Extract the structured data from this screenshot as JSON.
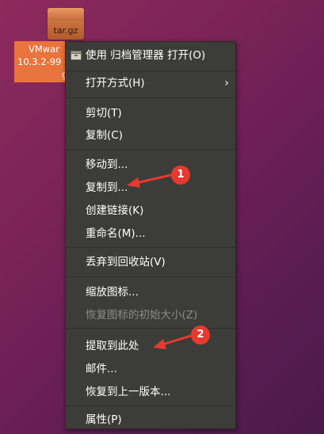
{
  "desktop": {
    "file": {
      "icon_label": "tar.gz",
      "name_line1": "VMwar",
      "name_line2": "10.3.2-99",
      "name_line3": "g"
    }
  },
  "context_menu": {
    "items": [
      {
        "label": "使用 归档管理器 打开(O)"
      },
      {
        "label": "打开方式(H)"
      },
      {
        "label": "剪切(T)"
      },
      {
        "label": "复制(C)"
      },
      {
        "label": "移动到..."
      },
      {
        "label": "复制到..."
      },
      {
        "label": "创建链接(K)"
      },
      {
        "label": "重命名(M)..."
      },
      {
        "label": "丢弃到回收站(V)"
      },
      {
        "label": "缩放图标..."
      },
      {
        "label": "恢复图标的初始大小(Z)"
      },
      {
        "label": "提取到此处"
      },
      {
        "label": "邮件..."
      },
      {
        "label": "恢复到上一版本..."
      },
      {
        "label": "属性(P)"
      }
    ],
    "submenu_arrow": "›"
  },
  "annotations": {
    "badge1": "1",
    "badge2": "2",
    "color": "#e8392f"
  }
}
